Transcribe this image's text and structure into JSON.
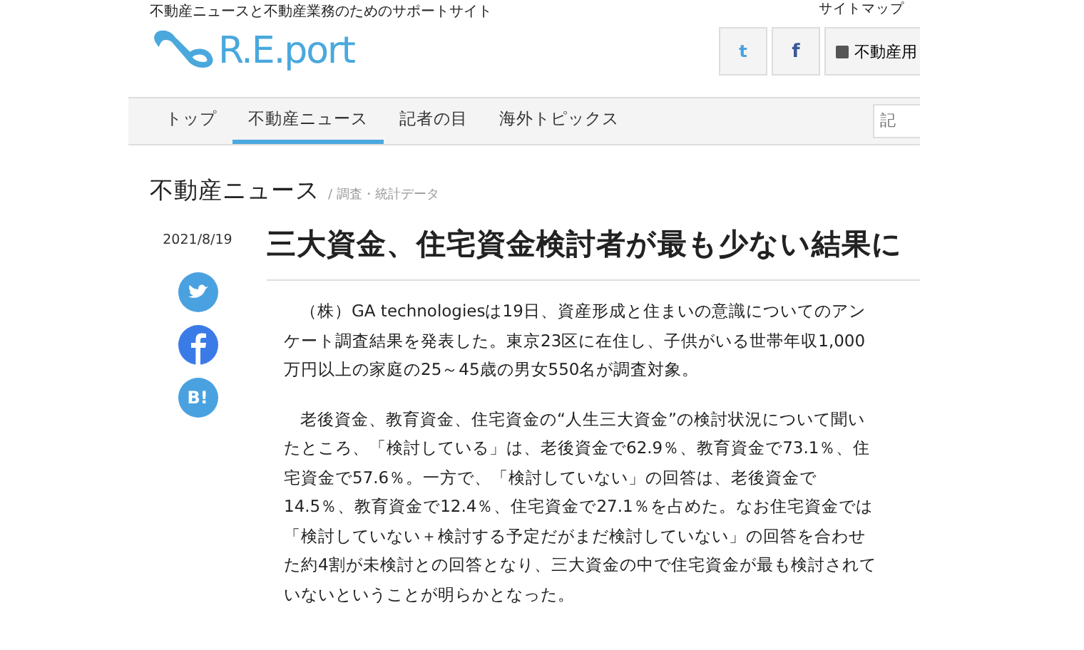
{
  "header": {
    "tagline": "不動産ニュースと不動産業務のためのサポートサイト",
    "logo": "R.E.port",
    "sitemap": "サイトマップ",
    "buttons": [
      {
        "kind": "twitter",
        "label": "t"
      },
      {
        "kind": "facebook",
        "label": "f"
      },
      {
        "kind": "glossary",
        "label": "不動産用"
      }
    ]
  },
  "nav": {
    "items": [
      {
        "label": "トップ",
        "selected": false
      },
      {
        "label": "不動産ニュース",
        "selected": true
      },
      {
        "label": "記者の目",
        "selected": false
      },
      {
        "label": "海外トピックス",
        "selected": false
      }
    ],
    "search": {
      "placeholder": "記"
    }
  },
  "section": {
    "title": "不動産ニュース",
    "category": "/ 調査・統計データ"
  },
  "article": {
    "date": "2021/8/19",
    "title": "三大資金、住宅資金検討者が最も少ない結果に",
    "share": [
      {
        "kind": "twitter"
      },
      {
        "kind": "facebook"
      },
      {
        "kind": "hatena",
        "label": "B!"
      }
    ],
    "paragraphs": [
      "（株）GA technologiesは19日、資産形成と住まいの意識についてのアンケート調査結果を発表した。東京23区に在住し、子供がいる世帯年収1,000万円以上の家庭の25～45歳の男女550名が調査対象。",
      "老後資金、教育資金、住宅資金の“人生三大資金”の検討状況について聞いたところ、「検討している」は、老後資金で62.9％、教育資金で73.1％、住宅資金で57.6％。一方で、「検討していない」の回答は、老後資金で14.5％、教育資金で12.4％、住宅資金で27.1％を占めた。なお住宅資金では「検討していない＋検討する予定だがまだ検討していない」の回答を合わせた約4割が未検討との回答となり、三大資金の中で住宅資金が最も検討されていないということが明らかとなった。"
    ]
  }
}
